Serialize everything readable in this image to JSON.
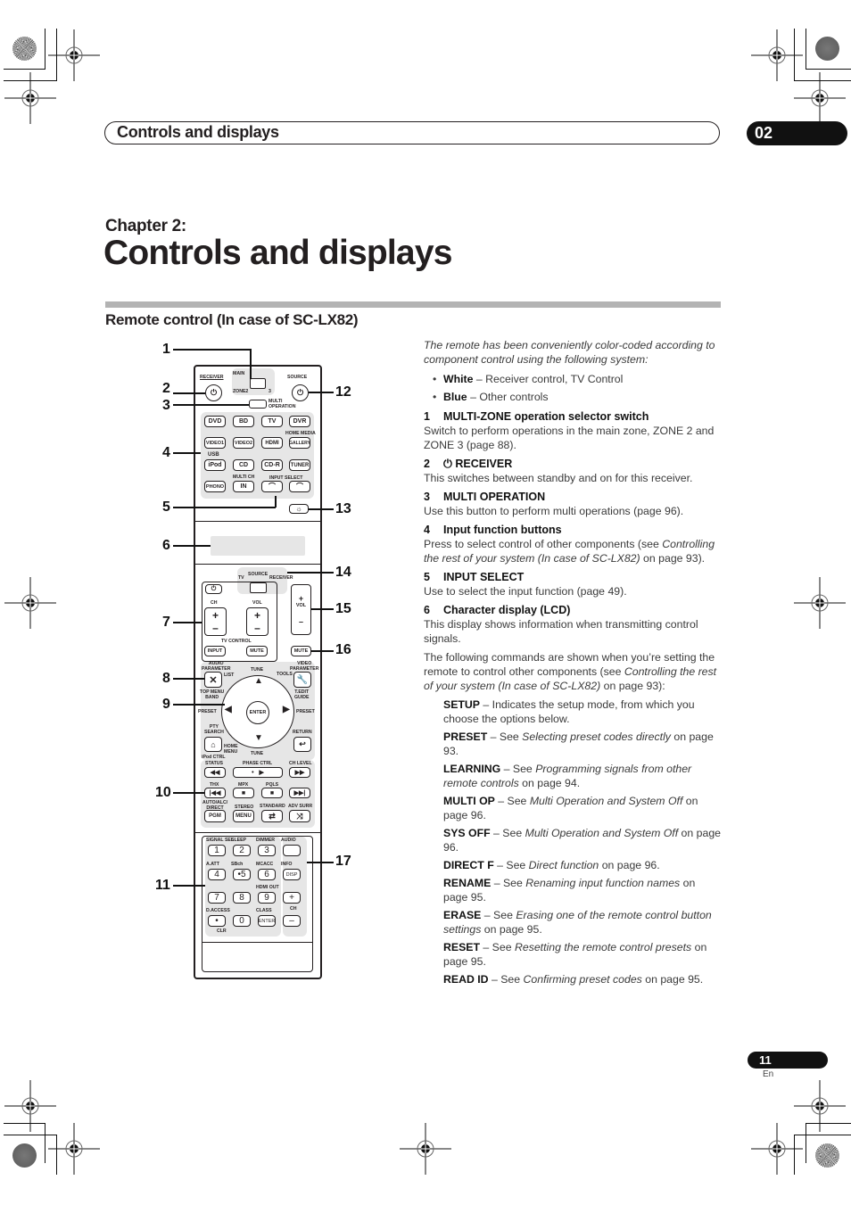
{
  "header": {
    "section_title": "Controls and displays",
    "chapter_number": "02"
  },
  "chapter": {
    "label": "Chapter 2:",
    "title": "Controls and displays"
  },
  "section": {
    "title": "Remote control (In case of SC-LX82)"
  },
  "callouts": [
    "1",
    "2",
    "3",
    "4",
    "5",
    "6",
    "7",
    "8",
    "9",
    "10",
    "11",
    "12",
    "13",
    "14",
    "15",
    "16",
    "17"
  ],
  "remote": {
    "receiver": "RECEIVER",
    "main": "MAIN",
    "zone2": "ZONE2",
    "zone3": "3",
    "source": "SOURCE",
    "multi_operation": "MULTI\nOPERATION",
    "inputs_row1": [
      "DVD",
      "BD",
      "TV",
      "DVR"
    ],
    "inputs_row2": [
      "VIDEO1",
      "VIDEO2",
      "HDMI",
      "GALLERY"
    ],
    "home_media": "HOME MEDIA",
    "usb": "USB",
    "inputs_row3": [
      "iPod",
      "CD",
      "CD-R",
      "TUNER"
    ],
    "multi_ch": "MULTI CH",
    "phono": "PHONO",
    "in": "IN",
    "input_select": "INPUT SELECT",
    "light_icon": "light-icon",
    "tv": "TV",
    "source_switch": "SOURCE",
    "receiver_switch": "RECEIVER",
    "ch": "CH",
    "vol": "VOL",
    "tv_control": "TV CONTROL",
    "input": "INPUT",
    "mute": "MUTE",
    "mute2": "MUTE",
    "vol2": "VOL",
    "plus": "+",
    "minus": "–",
    "audio_parameter": "AUDIO\nPARAMETER",
    "video_parameter": "VIDEO\nPARAMETER",
    "list": "LIST",
    "tools": "TOOLS",
    "tune": "TUNE",
    "top_menu": "TOP MENU\nBAND",
    "t_edit": "T.EDIT\nGUIDE",
    "preset": "PRESET",
    "enter": "ENTER",
    "pty_search": "PTY\nSEARCH",
    "return": "RETURN",
    "home_menu": "HOME\nMENU",
    "ipod_ctrl": "iPod CTRL",
    "status": "STATUS",
    "phase_ctrl": "PHASE CTRL",
    "ch_level": "CH LEVEL",
    "thx": "THX",
    "mpx": "MPX",
    "pqls": "PQLS",
    "auto_alc": "AUTO/ALC/\nDIRECT",
    "stereo": "STEREO",
    "standard": "STANDARD",
    "adv_surr": "ADV SURR",
    "pgm": "PGM",
    "menu": "MENU",
    "keypad_labels": [
      "SIGNAL SEL",
      "SLEEP",
      "DIMMER",
      "AUDIO",
      "A.ATT",
      "SBch",
      "MCACC",
      "INFO",
      "",
      "",
      "HDMI OUT",
      "",
      "D.ACCESS",
      "",
      "CLASS",
      ""
    ],
    "keypad_keys": [
      "1",
      "2",
      "3",
      "",
      "4",
      "•5",
      "6",
      "DISP",
      "7",
      "8",
      "9",
      "+",
      "•",
      "0",
      "ENTER",
      "–"
    ],
    "ch_small": "CH",
    "clr": "CLR"
  },
  "content": {
    "intro": "The remote has been conveniently color-coded according to component control using the following system:",
    "bullets": [
      {
        "bold": "White",
        "text": " – Receiver control, TV Control"
      },
      {
        "bold": "Blue",
        "text": " – Other controls"
      }
    ],
    "items": [
      {
        "num": "1",
        "title": "MULTI-ZONE operation selector switch",
        "body": "Switch to perform operations in the main zone, ZONE 2 and ZONE 3 (page 88)."
      },
      {
        "num": "2",
        "title": "⏻ RECEIVER",
        "body": "This switches between standby and on for this receiver."
      },
      {
        "num": "3",
        "title": "MULTI OPERATION",
        "body": "Use this button to perform multi operations (page 96)."
      },
      {
        "num": "4",
        "title": "Input function buttons",
        "body_pre": "Press to select control of other components (see ",
        "body_italic": "Controlling the rest of your system (In case of SC-LX82)",
        "body_post": " on page 93)."
      },
      {
        "num": "5",
        "title": "INPUT SELECT",
        "body": "Use to select the input function (page 49)."
      },
      {
        "num": "6",
        "title": "Character display (LCD)",
        "body": "This display shows information when transmitting control signals."
      }
    ],
    "following_pre": "The following commands are shown when you’re setting the remote to control other components (see ",
    "following_italic": "Controlling the rest of your system (In case of SC-LX82)",
    "following_post": " on page 93):",
    "commands": [
      {
        "name": "SETUP",
        "pre": " – Indicates the setup mode, from which you choose the options below.",
        "italic": "",
        "post": ""
      },
      {
        "name": "PRESET",
        "pre": " – See ",
        "italic": "Selecting preset codes directly",
        "post": " on page 93."
      },
      {
        "name": "LEARNING",
        "pre": " – See ",
        "italic": "Programming signals from other remote controls",
        "post": " on page 94."
      },
      {
        "name": "MULTI OP",
        "pre": " – See ",
        "italic": "Multi Operation and System Off",
        "post": " on page 96."
      },
      {
        "name": "SYS OFF",
        "pre": " – See ",
        "italic": "Multi Operation and System Off",
        "post": " on page 96."
      },
      {
        "name": "DIRECT F",
        "pre": " – See ",
        "italic": "Direct function",
        "post": " on page 96."
      },
      {
        "name": "RENAME",
        "pre": " – See ",
        "italic": "Renaming input function names",
        "post": " on page 95."
      },
      {
        "name": "ERASE",
        "pre": " – See ",
        "italic": "Erasing one of the remote control button settings",
        "post": " on page 95."
      },
      {
        "name": "RESET",
        "pre": " – See ",
        "italic": "Resetting the remote control presets",
        "post": " on page 95."
      },
      {
        "name": "READ ID",
        "pre": " – See ",
        "italic": "Confirming preset codes",
        "post": " on page 95."
      }
    ]
  },
  "footer": {
    "page_number": "11",
    "language": "En"
  }
}
